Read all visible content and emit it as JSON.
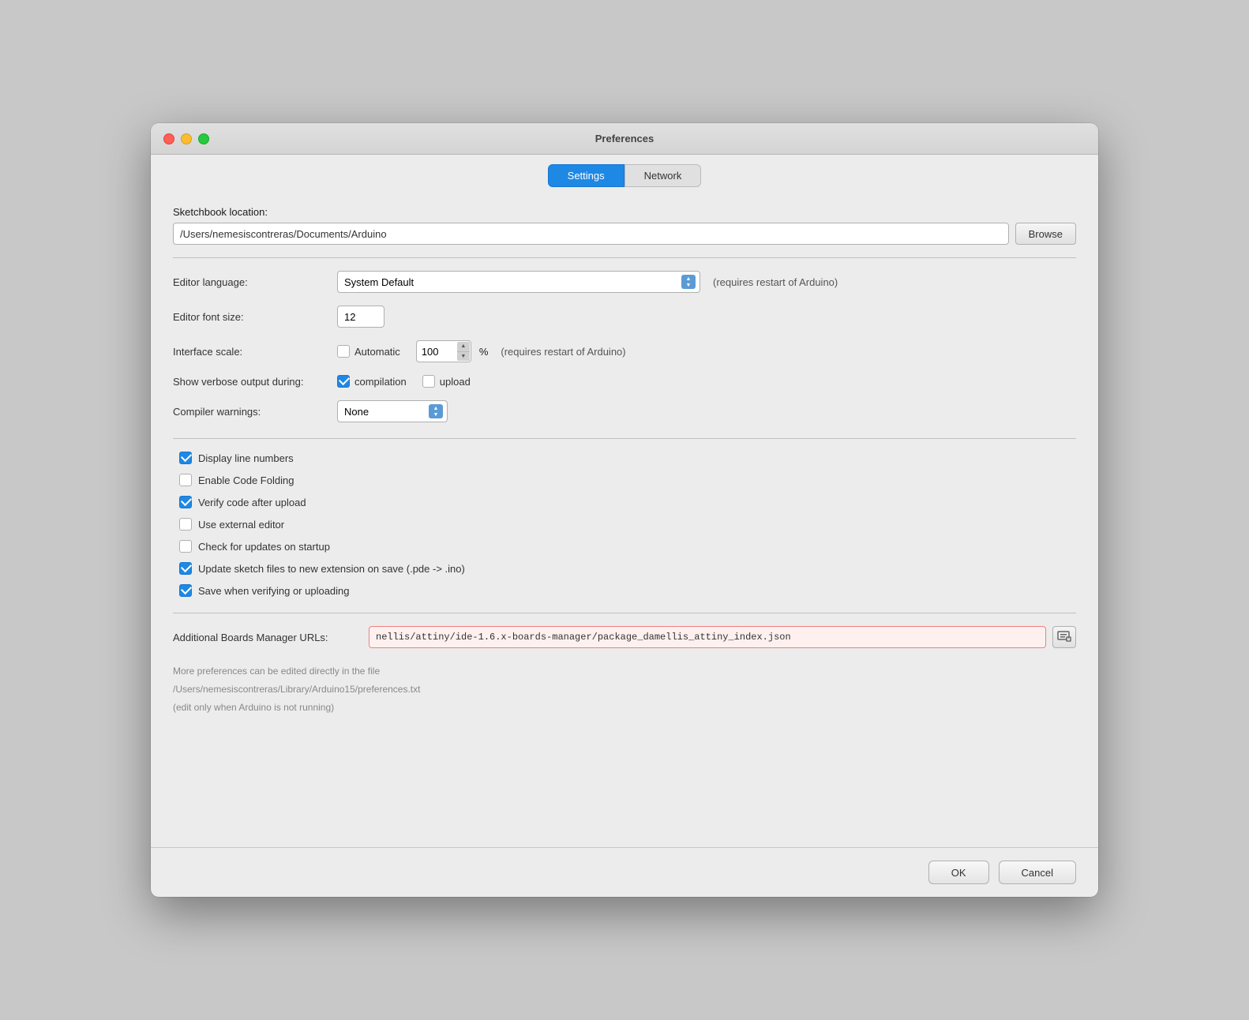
{
  "window": {
    "title": "Preferences"
  },
  "tabs": [
    {
      "id": "settings",
      "label": "Settings",
      "active": true
    },
    {
      "id": "network",
      "label": "Network",
      "active": false
    }
  ],
  "sketchbook": {
    "label": "Sketchbook location:",
    "value": "/Users/nemesiscontreras/Documents/Arduino",
    "browse_label": "Browse"
  },
  "editor_language": {
    "label": "Editor language:",
    "value": "System Default",
    "note": "(requires restart of Arduino)"
  },
  "editor_font_size": {
    "label": "Editor font size:",
    "value": "12"
  },
  "interface_scale": {
    "label": "Interface scale:",
    "automatic_label": "Automatic",
    "automatic_checked": false,
    "value": "100",
    "percent": "%",
    "note": "(requires restart of Arduino)"
  },
  "verbose_output": {
    "label": "Show verbose output during:",
    "compilation_label": "compilation",
    "compilation_checked": true,
    "upload_label": "upload",
    "upload_checked": false
  },
  "compiler_warnings": {
    "label": "Compiler warnings:",
    "value": "None"
  },
  "checkboxes": [
    {
      "id": "display-line-numbers",
      "label": "Display line numbers",
      "checked": true
    },
    {
      "id": "enable-code-folding",
      "label": "Enable Code Folding",
      "checked": false
    },
    {
      "id": "verify-code-after-upload",
      "label": "Verify code after upload",
      "checked": true
    },
    {
      "id": "use-external-editor",
      "label": "Use external editor",
      "checked": false
    },
    {
      "id": "check-for-updates",
      "label": "Check for updates on startup",
      "checked": false
    },
    {
      "id": "update-sketch-files",
      "label": "Update sketch files to new extension on save (.pde -> .ino)",
      "checked": true
    },
    {
      "id": "save-when-verifying",
      "label": "Save when verifying or uploading",
      "checked": true
    }
  ],
  "additional_boards": {
    "label": "Additional Boards Manager URLs:",
    "value": "nellis/attiny/ide-1.6.x-boards-manager/package_damellis_attiny_index.json"
  },
  "more_prefs": {
    "line1": "More preferences can be edited directly in the file",
    "line2": "/Users/nemesiscontreras/Library/Arduino15/preferences.txt",
    "line3": "(edit only when Arduino is not running)"
  },
  "footer": {
    "ok_label": "OK",
    "cancel_label": "Cancel"
  }
}
